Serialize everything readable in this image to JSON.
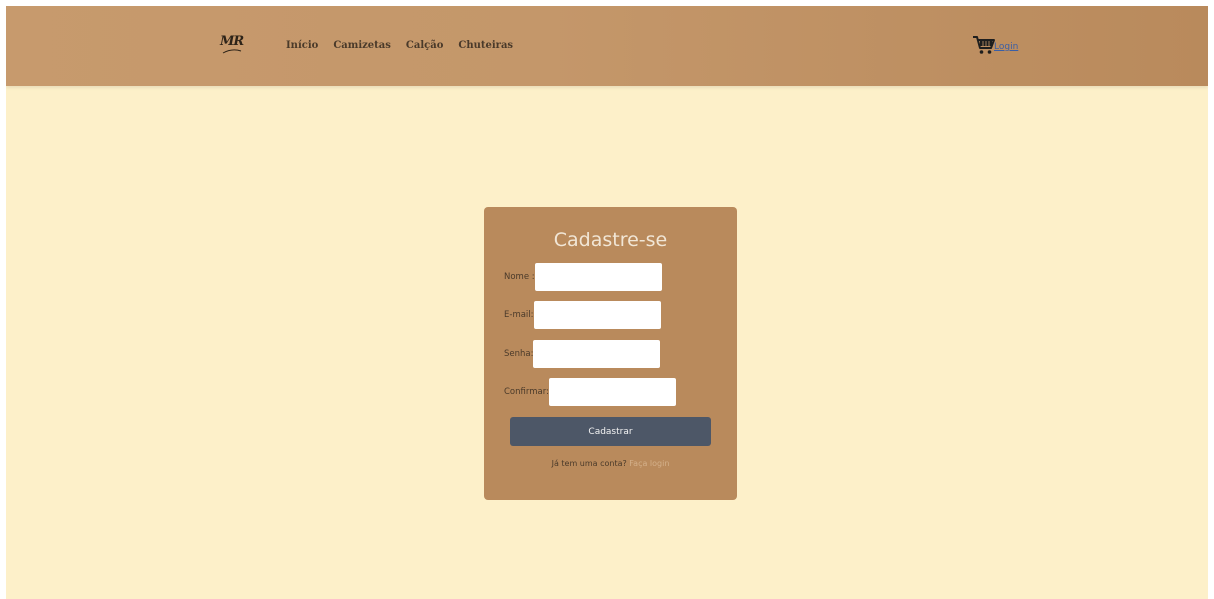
{
  "header": {
    "logo_text": "MR",
    "nav": [
      {
        "label": "Início"
      },
      {
        "label": "Camizetas"
      },
      {
        "label": "Calção"
      },
      {
        "label": "Chuteiras"
      }
    ],
    "cart_icon": "shopping-cart-icon",
    "login_label": "Login"
  },
  "signup": {
    "title": "Cadastre-se",
    "fields": {
      "name_label": "Nome :",
      "name_value": "",
      "email_label": "E-mail:",
      "email_value": "",
      "password_label": "Senha:",
      "password_value": "",
      "confirm_label": "Confirmar:",
      "confirm_value": ""
    },
    "submit_label": "Cadastrar",
    "account_prompt": "Já tem uma conta?",
    "login_link": "Faça login"
  },
  "colors": {
    "page_background": "#fdf0c9",
    "header_background": "#c4976a",
    "card_background": "#b98a5c",
    "button_background": "#4d5767",
    "login_link": "#3a5fa6"
  }
}
